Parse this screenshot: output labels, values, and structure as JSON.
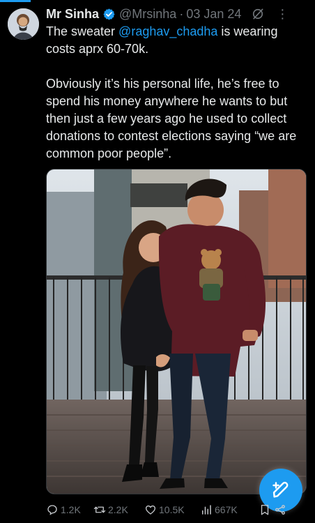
{
  "tweet": {
    "author_name": "Mr Sinha",
    "handle": "@Mrsinha",
    "separator": "·",
    "date": "03 Jan 24",
    "text_before_mention": "The sweater ",
    "mention": "@raghav_chadha",
    "text_after_mention": " is wearing\ncosts aprx 60-70k.\n\nObviously it’s his personal life, he’s free to spend his money anywhere he wants to but then just a few years ago he used to collect donations to contest elections saying “we are common poor people”.",
    "icons": {
      "verified": "verified-badge-icon",
      "grok": "grok-icon",
      "more": "more-options-icon"
    }
  },
  "actions": {
    "replies": "1.2K",
    "reposts": "2.2K",
    "likes": "10.5K",
    "views": "667K",
    "icons": [
      "reply-icon",
      "repost-icon",
      "like-icon",
      "views-icon",
      "bookmark-icon",
      "share-icon"
    ]
  },
  "fab": {
    "icon": "compose-post-icon"
  },
  "colors": {
    "background": "#000000",
    "text": "#e7e9ea",
    "muted": "#71767b",
    "accent": "#1d9bf0"
  }
}
